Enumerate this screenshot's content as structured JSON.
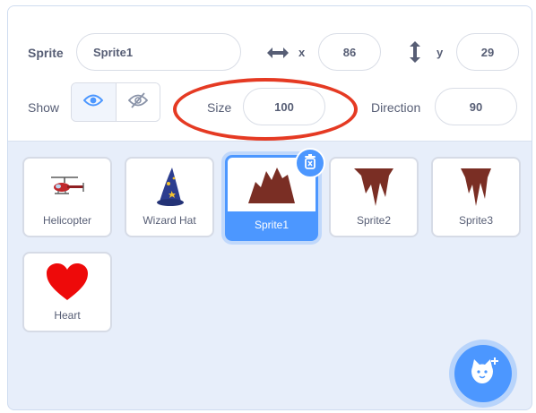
{
  "sprite_info": {
    "sprite_label": "Sprite",
    "sprite_name": "Sprite1",
    "x_label": "x",
    "x_value": "86",
    "y_label": "y",
    "y_value": "29",
    "show_label": "Show",
    "size_label": "Size",
    "size_value": "100",
    "direction_label": "Direction",
    "direction_value": "90"
  },
  "sprites": [
    {
      "name": "Helicopter",
      "icon": "helicopter-icon"
    },
    {
      "name": "Wizard Hat",
      "icon": "wizard-hat-icon"
    },
    {
      "name": "Sprite1",
      "icon": "sprite1-icon",
      "selected": true
    },
    {
      "name": "Sprite2",
      "icon": "sprite2-icon"
    },
    {
      "name": "Sprite3",
      "icon": "sprite3-icon"
    },
    {
      "name": "Heart",
      "icon": "heart-icon"
    }
  ],
  "colors": {
    "accent": "#4c97ff",
    "highlight": "#e53a23",
    "panel_bg": "#e7eefa",
    "text": "#575e75"
  },
  "icons": {
    "visible": "eye-icon",
    "hidden": "eye-slash-icon",
    "delete": "trash-icon",
    "add_sprite": "cat-plus-icon",
    "x": "horizontal-arrows-icon",
    "y": "vertical-arrows-icon"
  }
}
